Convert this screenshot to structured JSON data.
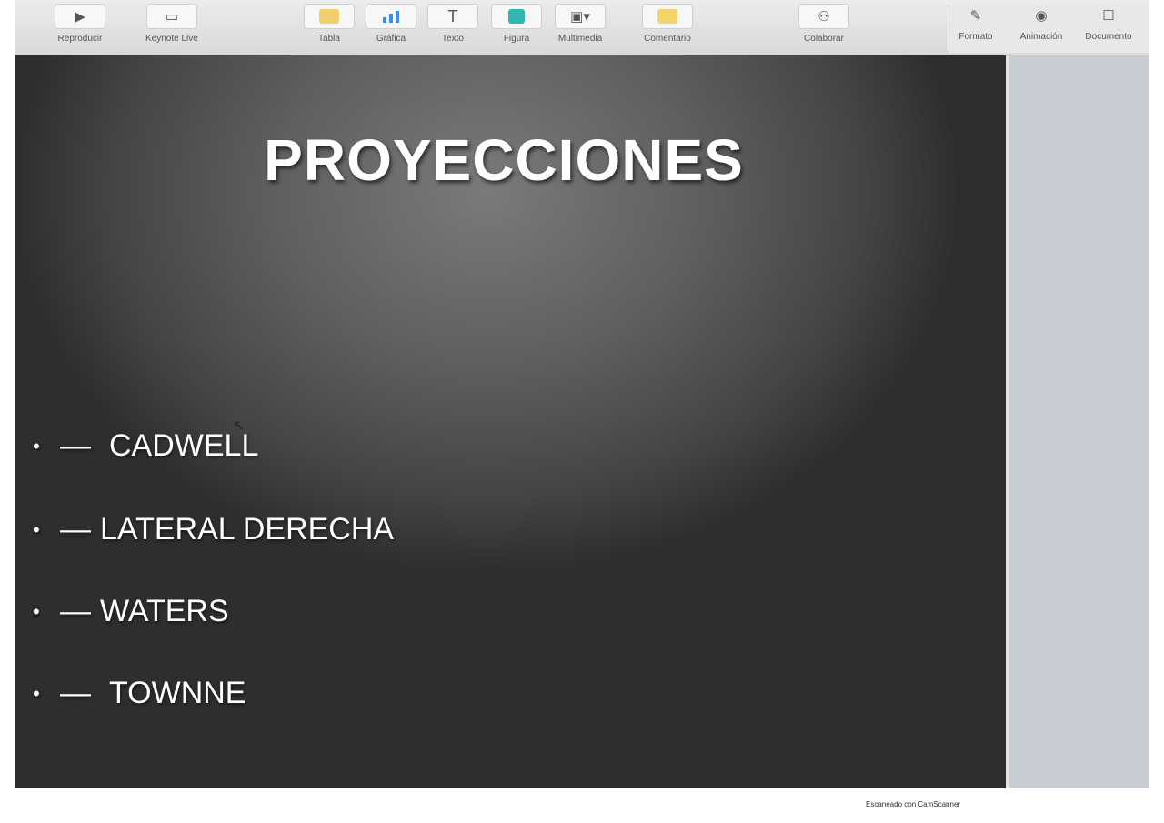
{
  "toolbar": {
    "play_label": "Reproducir",
    "keynote_live_label": "Keynote Live",
    "table_label": "Tabla",
    "chart_label": "Gráfica",
    "text_label": "Texto",
    "shape_label": "Figura",
    "media_label": "Multimedia",
    "comment_label": "Comentario",
    "collaborate_label": "Colaborar",
    "format_label": "Formato",
    "animate_label": "Animación",
    "document_label": "Documento",
    "colors": {
      "table": "#f1cf6b",
      "shape": "#2fb7b0",
      "comment": "#f3d46a"
    }
  },
  "slide": {
    "title": "PROYECCIONES",
    "bullets": [
      {
        "dash": "—",
        "text": "CADWELL"
      },
      {
        "dash": "—",
        "text": "LATERAL DERECHA"
      },
      {
        "dash": "—",
        "text": "WATERS"
      },
      {
        "dash": "—",
        "text": "TOWNNE"
      }
    ]
  },
  "footer": {
    "scan_note": "Escaneado con CamScanner"
  }
}
